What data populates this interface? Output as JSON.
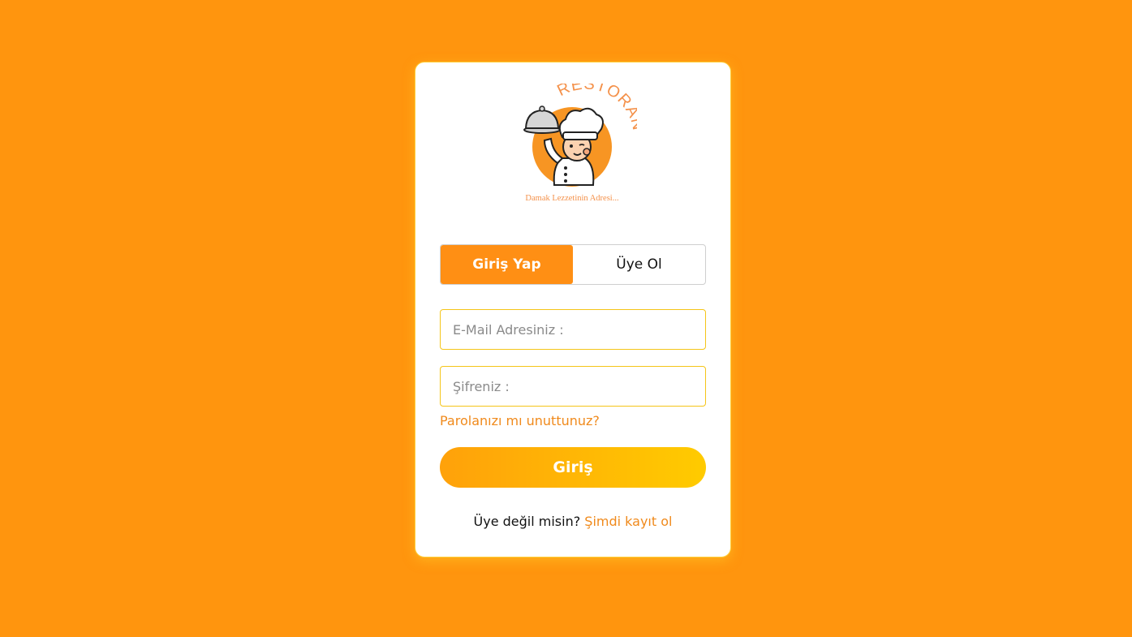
{
  "brand": {
    "arc_text": "RESTORAN",
    "tagline": "Damak Lezzetinin Adresi..."
  },
  "tabs": [
    {
      "label": "Giriş Yap",
      "active": true
    },
    {
      "label": "Üye Ol",
      "active": false
    }
  ],
  "form": {
    "email_placeholder": "E-Mail Adresiniz :",
    "email_value": "",
    "password_placeholder": "Şifreniz :",
    "password_value": "",
    "forgot_link": "Parolanızı mı unuttunuz?",
    "submit_label": "Giriş"
  },
  "footer": {
    "prompt": "Üye değil misin?",
    "link": "Şimdi kayıt ol"
  },
  "colors": {
    "background": "#ff950e",
    "accent": "#ff8f14",
    "link": "#f08a1c",
    "button_gradient_start": "#ffa10a",
    "button_gradient_end": "#ffcb00",
    "input_border": "#f5c518"
  },
  "icons": {
    "logo": "chef-holding-cloche-logo"
  }
}
